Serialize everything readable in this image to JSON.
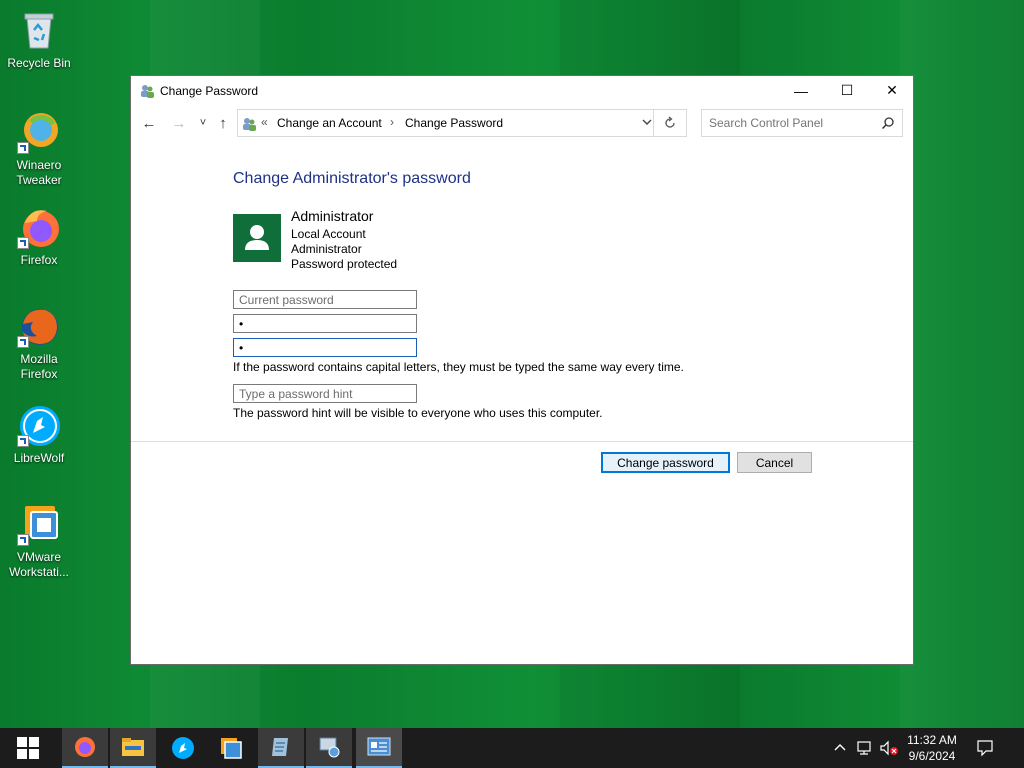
{
  "desktop": {
    "icons": [
      {
        "label": "Recycle Bin",
        "icon": "recycle-bin-icon"
      },
      {
        "label": "Winaero\nTweaker",
        "icon": "winaero-tweaker-icon"
      },
      {
        "label": "Firefox",
        "icon": "firefox-icon"
      },
      {
        "label": "Mozilla\nFirefox",
        "icon": "mozilla-firefox-icon"
      },
      {
        "label": "LibreWolf",
        "icon": "librewolf-icon"
      },
      {
        "label": "VMware\nWorkstati...",
        "icon": "vmware-workstation-icon"
      }
    ]
  },
  "window": {
    "title": "Change Password",
    "controls": {
      "minimize": "—",
      "maximize": "☐",
      "close": "✕"
    },
    "nav": {
      "back": "←",
      "forward": "→",
      "recent": "˅",
      "up": "↑"
    },
    "breadcrumb": {
      "overflow": "«",
      "items": [
        "Change an Account",
        "Change Password"
      ],
      "separator": "›"
    },
    "search": {
      "placeholder": "Search Control Panel"
    },
    "heading": "Change Administrator's password",
    "account": {
      "name": "Administrator",
      "lines": [
        "Local Account",
        "Administrator",
        "Password protected"
      ]
    },
    "form": {
      "current_password_placeholder": "Current password",
      "new_password_value": "•",
      "confirm_password_value": "•",
      "capital_note": "If the password contains capital letters, they must be typed the same way every time.",
      "hint_placeholder": "Type a password hint",
      "hint_note": "The password hint will be visible to everyone who uses this computer."
    },
    "buttons": {
      "change": "Change password",
      "cancel": "Cancel"
    }
  },
  "taskbar": {
    "start": "start-icon",
    "apps": [
      "firefox-icon",
      "file-explorer-icon",
      "librewolf-icon",
      "vmware-icon",
      "notepad-icon",
      "control-panel-tool-icon",
      "control-panel-icon"
    ],
    "clock": {
      "time": "11:32 AM",
      "date": "9/6/2024"
    }
  }
}
